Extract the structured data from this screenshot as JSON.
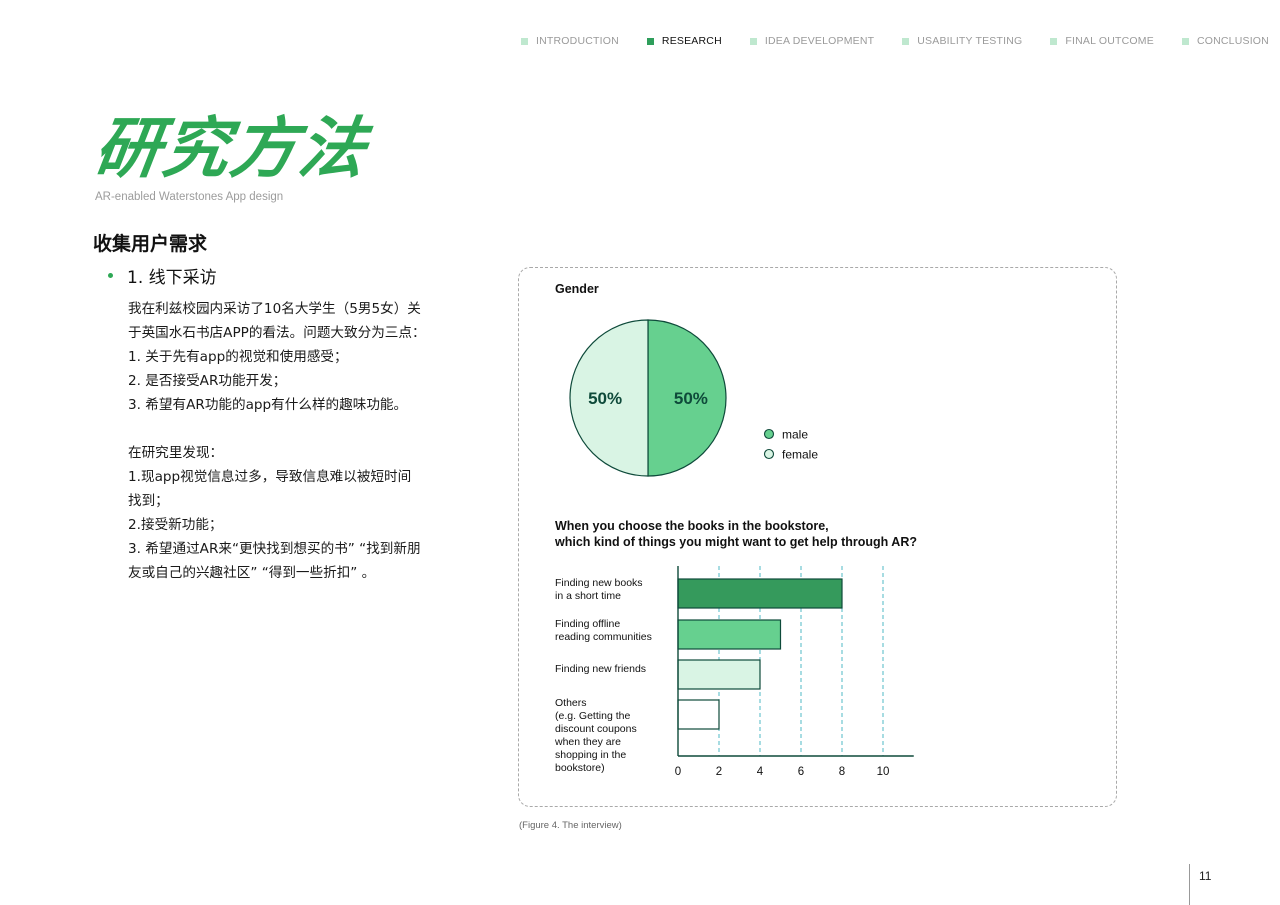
{
  "nav": {
    "items": [
      {
        "label": "INTRODUCTION",
        "active": false
      },
      {
        "label": "RESEARCH",
        "active": true
      },
      {
        "label": "IDEA DEVELOPMENT",
        "active": false
      },
      {
        "label": "USABILITY TESTING",
        "active": false
      },
      {
        "label": "FINAL OUTCOME",
        "active": false
      },
      {
        "label": "CONCLUSION",
        "active": false
      }
    ]
  },
  "header": {
    "title": "研究方法",
    "subtitle": "AR-enabled Waterstones App design"
  },
  "section": {
    "title": "收集用户需求",
    "bullet": "1. 线下采访",
    "paragraph1": [
      "我在利兹校园内采访了10名大学生（5男5女）关",
      "于英国水石书店APP的看法。问题大致分为三点：",
      "1. 关于先有app的视觉和使用感受；",
      "2. 是否接受AR功能开发；",
      "3. 希望有AR功能的app有什么样的趣味功能。"
    ],
    "paragraph2": [
      "在研究里发现：",
      "1.现app视觉信息过多，导致信息难以被短时间",
      "找到；",
      "2.接受新功能；",
      "3. 希望通过AR来“更快找到想买的书” “找到新朋",
      "友或自己的兴趣社区” “得到一些折扣” 。"
    ]
  },
  "chart_data": [
    {
      "type": "pie",
      "title": "Gender",
      "labels": [
        "male",
        "female"
      ],
      "values": [
        50,
        50
      ],
      "slice_labels": [
        "50%",
        "50%"
      ],
      "colors": [
        "#66d08f",
        "#d9f4e4"
      ],
      "legend": "right"
    },
    {
      "type": "bar",
      "orientation": "horizontal",
      "title_lines": [
        "When you choose the books in the bookstore,",
        "which kind of things you might want to get help through AR?"
      ],
      "categories": [
        [
          "Finding new books",
          "in a short time"
        ],
        [
          "Finding offline",
          "reading communities"
        ],
        [
          "Finding new friends"
        ],
        [
          "Others",
          "(e.g. Getting the",
          "discount coupons",
          "when they are",
          "shopping in the",
          "bookstore)"
        ]
      ],
      "values": [
        8,
        5,
        4,
        2
      ],
      "colors": [
        "#359a5c",
        "#66d08f",
        "#d9f4e4",
        "#ffffff"
      ],
      "xlim": [
        0,
        11.5
      ],
      "xticks": [
        0,
        2,
        4,
        6,
        8,
        10
      ],
      "grid": true
    }
  ],
  "caption": "(Figure 4. The interview)",
  "page_number": "11"
}
